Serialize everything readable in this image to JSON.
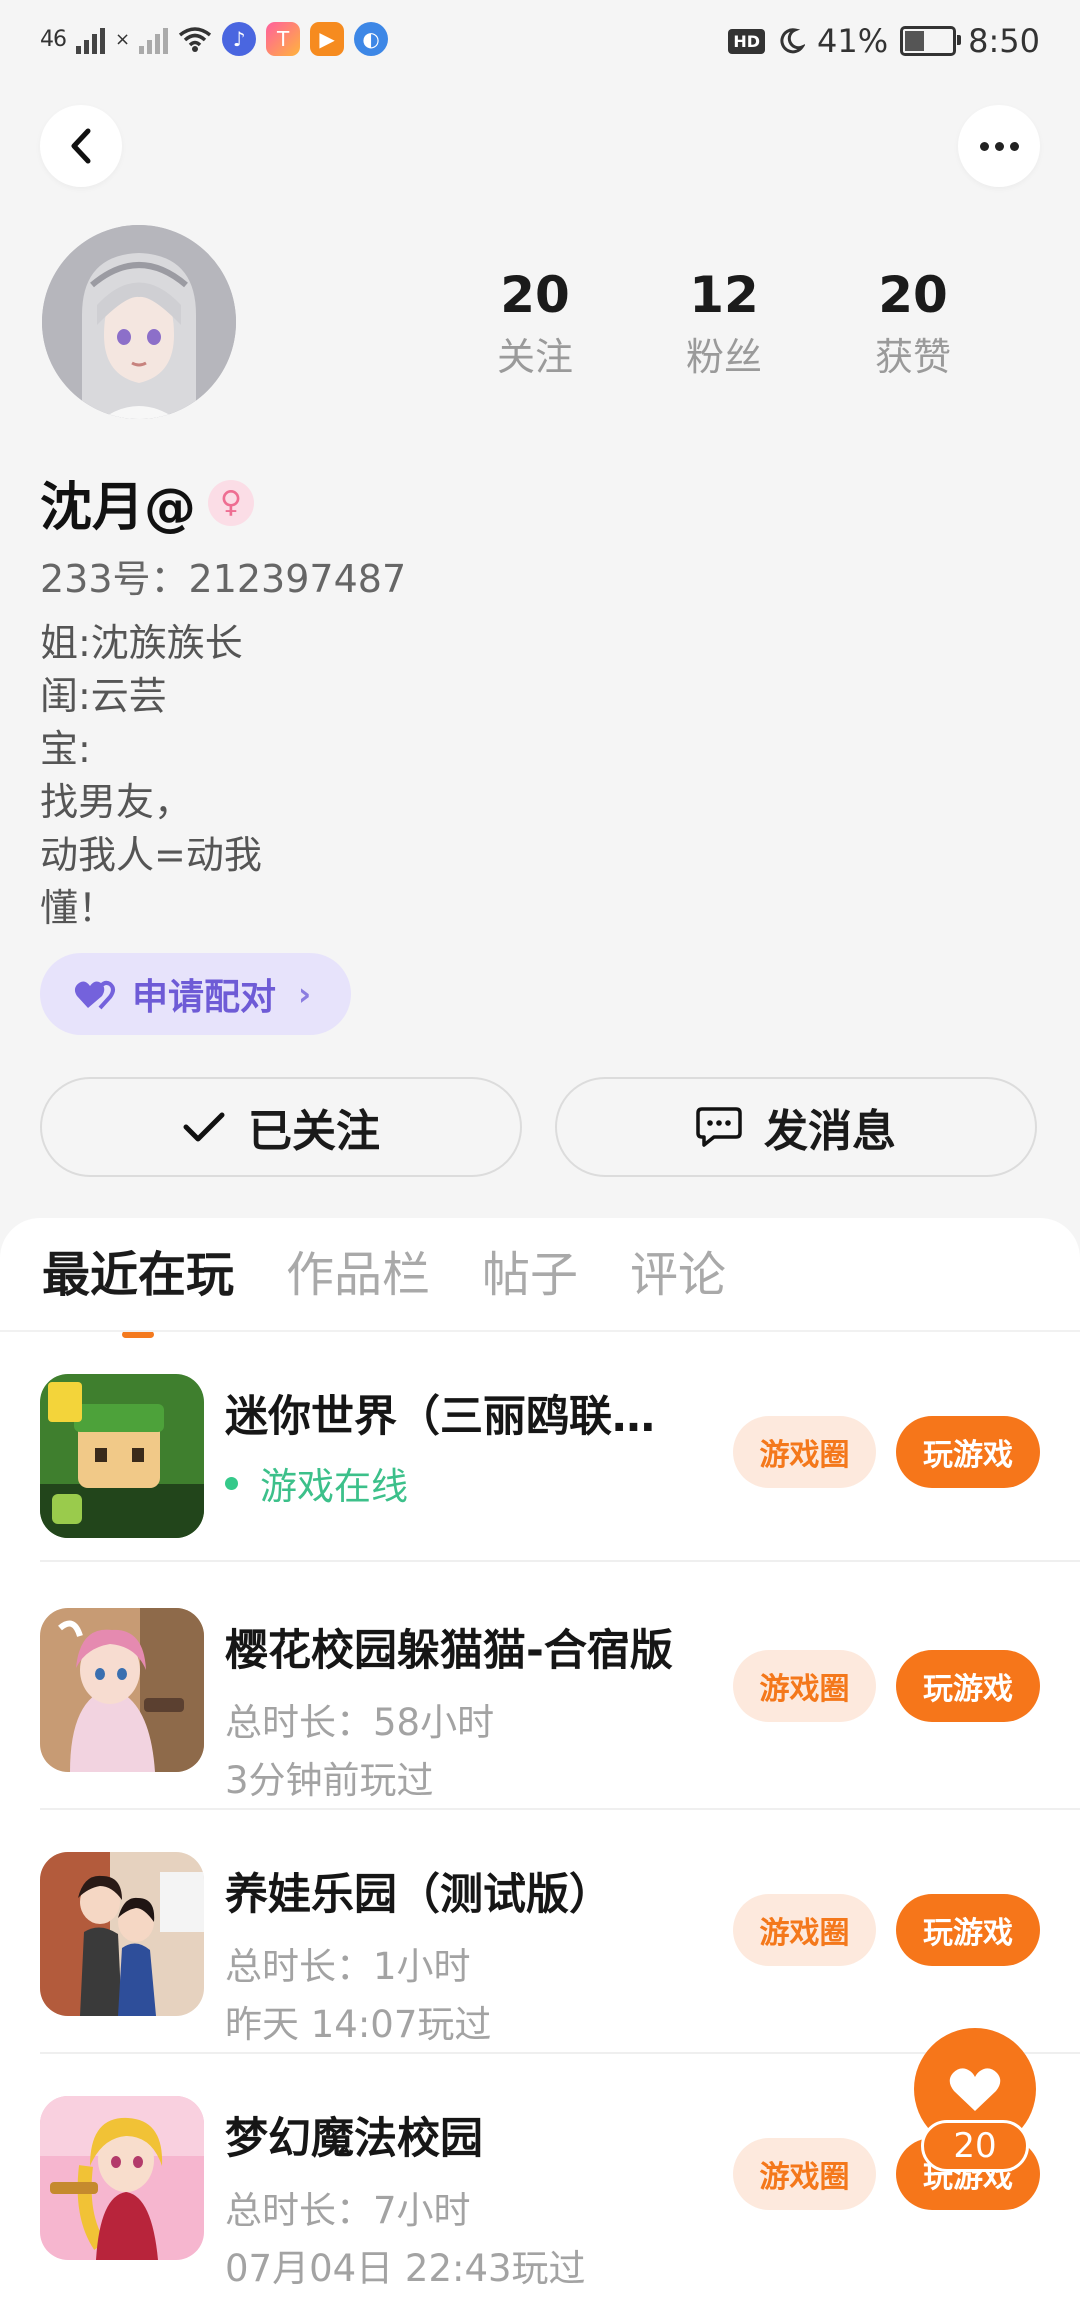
{
  "status_bar": {
    "network_label": "46",
    "x_mark": "×",
    "hd_label": "HD",
    "battery_percent": "41%",
    "time": "8:50"
  },
  "header": {
    "back_icon": "chevron-left-icon",
    "more_icon": "more-horizontal-icon"
  },
  "profile": {
    "stats": [
      {
        "value": "20",
        "label": "关注"
      },
      {
        "value": "12",
        "label": "粉丝"
      },
      {
        "value": "20",
        "label": "获赞"
      }
    ],
    "name": "沈月@",
    "gender_symbol": "♀",
    "id_line": "233号：212397487",
    "bio_lines": [
      "姐:沈族族长",
      "闺:云芸",
      "宝:",
      "找男友，",
      "动我人=动我",
      "懂！"
    ],
    "pair_button": "申请配对",
    "pair_chevron": "›"
  },
  "actions": {
    "follow": "已关注",
    "message": "发消息"
  },
  "tabs": [
    "最近在玩",
    "作品栏",
    "帖子",
    "评论"
  ],
  "games": [
    {
      "title": "迷你世界（三丽鸥联动版）",
      "line1": "游戏在线",
      "line2": "",
      "online": true
    },
    {
      "title": "樱花校园躲猫猫-合宿版",
      "line1": "总时长：58小时",
      "line2": "3分钟前玩过",
      "online": false
    },
    {
      "title": "养娃乐园（测试版）",
      "line1": "总时长：1小时",
      "line2": "昨天 14:07玩过",
      "online": false
    },
    {
      "title": "梦幻魔法校园",
      "line1": "总时长：7小时",
      "line2": "07月04日 22:43玩过",
      "online": false
    }
  ],
  "game_buttons": {
    "circle": "游戏圈",
    "play": "玩游戏"
  },
  "floating": {
    "count": "20"
  },
  "colors": {
    "accent": "#f6761a",
    "pair_bg": "#e7e3fb",
    "pair_text": "#6e5bd6",
    "online": "#35c98a"
  }
}
